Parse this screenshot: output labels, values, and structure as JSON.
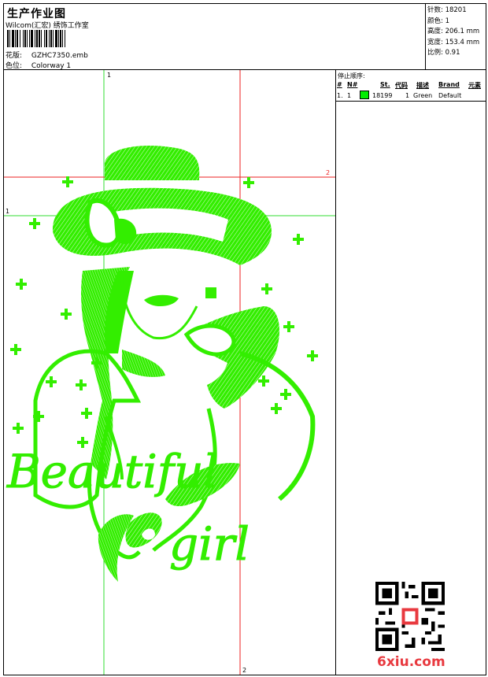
{
  "header": {
    "title": "生产作业图",
    "subtitle": "Wilcom(汇宏) 绣饰工作室",
    "design_label": "花版:",
    "design_value": "GZHC7350.emb",
    "colorway_label": "色位:",
    "colorway_value": "Colorway 1"
  },
  "stats": {
    "stitches": "针数: 18201",
    "colors": "颜色: 1",
    "height": "高度: 206.1 mm",
    "width": "宽度: 153.4 mm",
    "scale": "比例: 0.91"
  },
  "stop_sequence": {
    "title": "停止顺序:",
    "headers": [
      "#",
      "N#",
      "St.",
      "代码",
      "描述",
      "Brand",
      "元素"
    ],
    "rows": [
      {
        "index": "1.",
        "needle": "1",
        "stitches": "18199",
        "code": "1",
        "description": "Green",
        "brand": "Default"
      }
    ]
  },
  "guides": {
    "v1_label": "1",
    "v2_label": "2",
    "h1_label": "1",
    "h2_label": "2"
  },
  "design": {
    "word1": "Beautiful",
    "word2": "girl",
    "thread_color": "#33ee00"
  },
  "watermark": {
    "text": "6xiu.com",
    "color": "#e8393f"
  }
}
